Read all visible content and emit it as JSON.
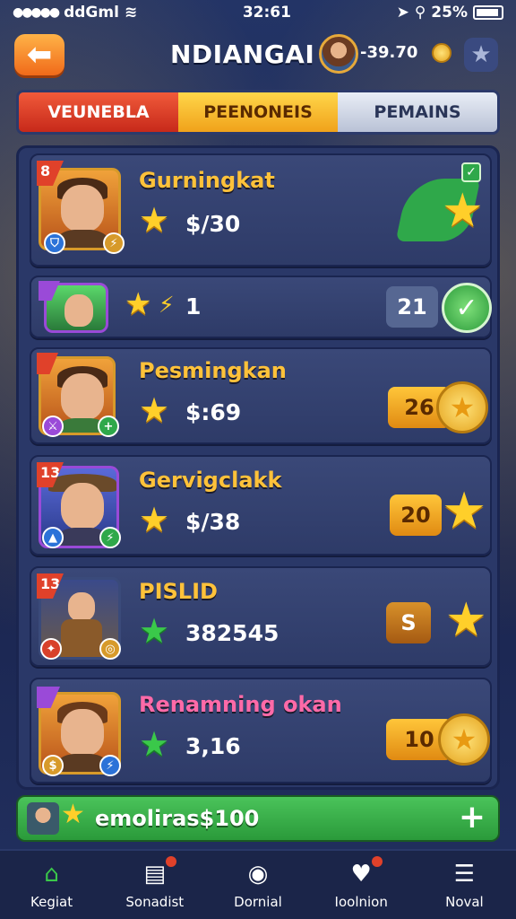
{
  "status_bar": {
    "carrier": "ddGml",
    "time": "32:61",
    "battery": "25%"
  },
  "header": {
    "title": "NDIANGAI",
    "currency": "-39.70"
  },
  "tabs": [
    {
      "label": "VEUNEBLA"
    },
    {
      "label": "PEENONEIS"
    },
    {
      "label": "PEMAINS"
    }
  ],
  "cards": [
    {
      "rank": "8",
      "name": "Gurningkat",
      "value": "$/30",
      "level": "",
      "star_color": "gold"
    },
    {
      "rank": "",
      "name": "",
      "value": "1",
      "level": "21",
      "star_color": "gold"
    },
    {
      "rank": "",
      "name": "Pesmingkan",
      "value": "$:69",
      "level": "26",
      "star_color": "gold"
    },
    {
      "rank": "13",
      "name": "Gervigclakk",
      "value": "$/38",
      "level": "20",
      "star_color": "gold"
    },
    {
      "rank": "13",
      "name": "PISLID",
      "value": "382545",
      "level": "S",
      "star_color": "green"
    },
    {
      "rank": "",
      "name": "Renamning okan",
      "value": "3,16",
      "level": "10",
      "star_color": "green"
    }
  ],
  "footer": {
    "label": "emoliras$100"
  },
  "nav": [
    {
      "label": "Kegiat",
      "icon": "home-icon"
    },
    {
      "label": "Sonadist",
      "icon": "chat-icon"
    },
    {
      "label": "Dornial",
      "icon": "compass-icon"
    },
    {
      "label": "Ioolnion",
      "icon": "heart-icon"
    },
    {
      "label": "Noval",
      "icon": "menu-icon"
    }
  ],
  "colors": {
    "accent_gold": "#ffc23a",
    "tab_red": "#e0412a",
    "tab_yellow": "#f0a21a",
    "footer_green": "#2fa84a"
  }
}
